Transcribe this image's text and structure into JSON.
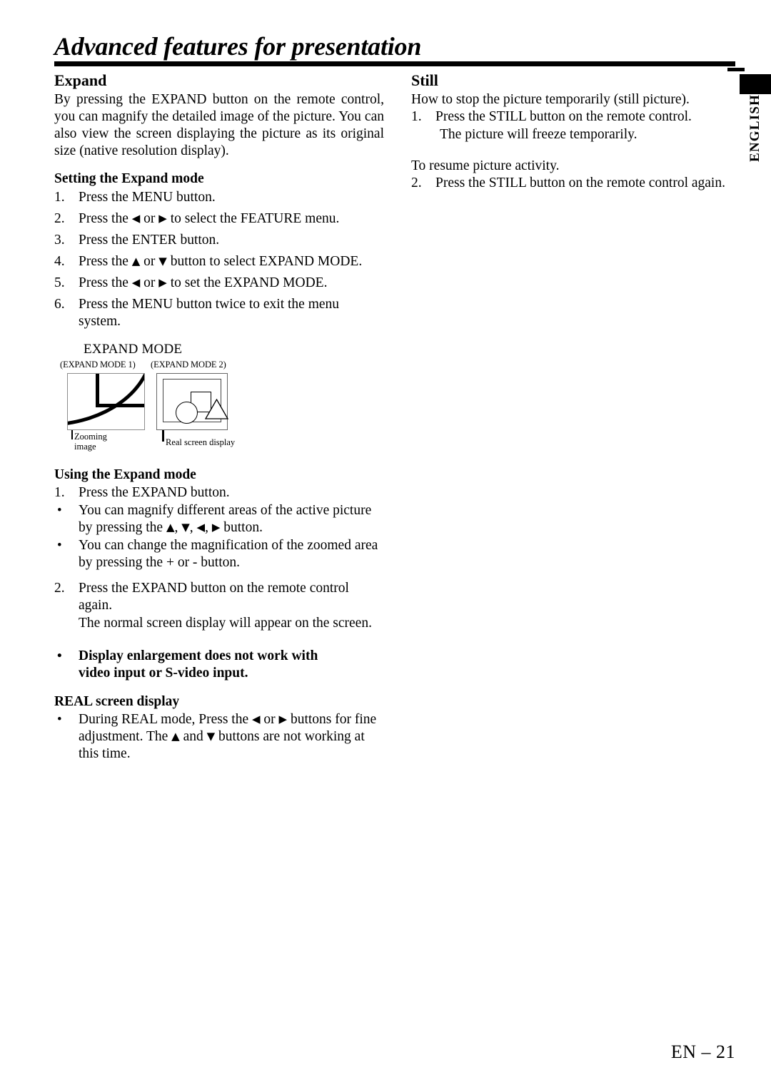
{
  "page": {
    "title": "Advanced features for presentation",
    "footer": "EN – 21",
    "side_tab": "ENGLISH"
  },
  "left_column": {
    "section_heading": "Expand",
    "intro": "By pressing the EXPAND button on the remote control, you can magnify the detailed image of the picture. You can also view the screen displaying the picture as its original size (native resolution display).",
    "setting_heading": "Setting the Expand mode",
    "setting_steps": [
      {
        "marker": "1.",
        "pre": "Press the MENU button.",
        "arrows": [],
        "post": ""
      },
      {
        "marker": "2.",
        "pre": "Press the ",
        "arrows": [
          "◀",
          "▶"
        ],
        "joiner": " or ",
        "post": " to select the FEATURE menu."
      },
      {
        "marker": "3.",
        "pre": "Press the ENTER button.",
        "arrows": [],
        "post": ""
      },
      {
        "marker": "4.",
        "pre": "Press the ",
        "arrows": [
          "▲",
          "▼"
        ],
        "joiner": " or ",
        "post": " button to select EXPAND MODE."
      },
      {
        "marker": "5.",
        "pre": "Press the ",
        "arrows": [
          "◀",
          "▶"
        ],
        "joiner": " or ",
        "post": " to set the EXPAND MODE."
      },
      {
        "marker": "6.",
        "pre": "Press the MENU button twice to exit the menu system.",
        "arrows": [],
        "post": ""
      }
    ],
    "figure": {
      "title": "EXPAND MODE",
      "sub_left": "(EXPAND MODE 1)",
      "sub_right": "(EXPAND MODE 2)",
      "caption_left_line1": "Zooming",
      "caption_left_line2": "image",
      "caption_right": "Real screen display"
    },
    "using_heading": "Using the Expand mode",
    "using_items": [
      {
        "marker": "1.",
        "text": "Press the EXPAND button."
      },
      {
        "marker": "•",
        "pre": "You can magnify different areas of the active picture by pressing the ",
        "arrows": [
          "▲",
          "▼",
          "◀",
          "▶"
        ],
        "post": " button."
      },
      {
        "marker": "•",
        "pre": "You can change the magnification of the zoomed area by pressing the + or - button.",
        "arrows": [],
        "post": ""
      }
    ],
    "step2": {
      "marker": "2.",
      "text": "Press the EXPAND button on the remote control again.",
      "extra": "The normal screen display will appear on the screen."
    },
    "warning": {
      "marker": "•",
      "line1": "Display enlargement does not work with",
      "line2": "video input or S-video input."
    },
    "real_heading": "REAL screen display",
    "real_item": {
      "marker": "•",
      "pre": "During REAL mode, Press the ",
      "arrows": [
        "◀",
        "▶"
      ],
      "mid": " or ",
      "mid2": " buttons for fine adjustment. The ",
      "mid3": " and ",
      "post": " buttons are not working at this time."
    }
  },
  "right_column": {
    "section_heading": "Still",
    "intro": "How to stop the picture temporarily (still picture).",
    "step1": {
      "marker": "1.",
      "text": "Press the STILL button on the remote control.",
      "extra": "The picture will freeze temporarily."
    },
    "resume_note": "To resume picture activity.",
    "step2": {
      "marker": "2.",
      "text": "Press the STILL button on the remote control again."
    }
  }
}
